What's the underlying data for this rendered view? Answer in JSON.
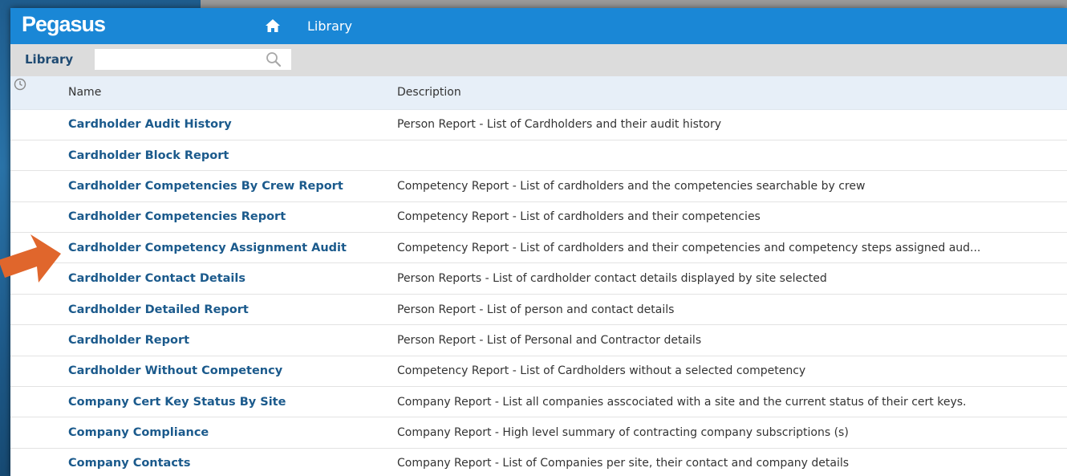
{
  "app": {
    "logo": "Pegasus",
    "breadcrumb": "Library"
  },
  "subbar": {
    "title": "Library",
    "search_value": "",
    "search_placeholder": ""
  },
  "table": {
    "columns": {
      "name": "Name",
      "description": "Description"
    },
    "rows": [
      {
        "name": "Cardholder Audit History",
        "description": "Person Report - List of Cardholders and their audit history"
      },
      {
        "name": "Cardholder Block Report",
        "description": ""
      },
      {
        "name": "Cardholder Competencies By Crew Report",
        "description": "Competency Report - List of cardholders and the competencies searchable by crew"
      },
      {
        "name": "Cardholder Competencies Report",
        "description": "Competency Report - List of cardholders and their competencies"
      },
      {
        "name": "Cardholder Competency Assignment Audit",
        "description": "Competency Report - List of cardholders and their competencies and competency steps assigned aud..."
      },
      {
        "name": "Cardholder Contact Details",
        "description": "Person Reports - List of cardholder contact details displayed by site selected"
      },
      {
        "name": "Cardholder Detailed Report",
        "description": "Person Report - List of person and contact details"
      },
      {
        "name": "Cardholder Report",
        "description": "Person Report - List of Personal and Contractor details"
      },
      {
        "name": "Cardholder Without Competency",
        "description": "Competency Report - List of Cardholders without a selected competency"
      },
      {
        "name": "Company Cert Key Status By Site",
        "description": "Company Report - List all companies asscociated with a site and the current status of their cert keys."
      },
      {
        "name": "Company Compliance",
        "description": "Company Report - High level summary of contracting company subscriptions (s)"
      },
      {
        "name": "Company Contacts",
        "description": "Company Report - List of Companies per site, their contact and company details"
      }
    ]
  },
  "colors": {
    "topbar": "#1a87d6",
    "link": "#1b5a8c",
    "arrow": "#e0662c"
  },
  "icons": [
    "home-icon",
    "search-icon",
    "clock-icon",
    "arrow-pointer"
  ]
}
